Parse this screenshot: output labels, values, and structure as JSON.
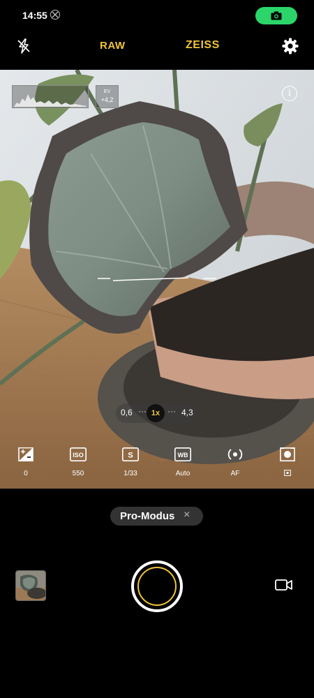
{
  "status_bar": {
    "time": "14:55",
    "icons": [
      "notification-icon",
      "camera-in-use-icon"
    ],
    "accent_color": "#2bd56a"
  },
  "top_bar": {
    "raw_label": "RAW",
    "zeiss_label": "ZEISS",
    "icons": [
      "flash-off-icon",
      "settings-icon"
    ],
    "accent_color": "#f0c43a"
  },
  "viewfinder": {
    "ev_label": "EV",
    "ev_value": "+4,2",
    "info_symbol": "i",
    "icons": [
      "histogram",
      "info-icon",
      "level-guide"
    ]
  },
  "zoom": {
    "min_label": "0,6",
    "current_label": "1x",
    "max_label": "4,3",
    "dots": "···"
  },
  "pro_controls": [
    {
      "name": "exposure-compensation",
      "value": "0",
      "icon": "exposure-icon"
    },
    {
      "name": "iso",
      "value": "550",
      "icon": "iso-icon",
      "icon_text": "ISO"
    },
    {
      "name": "shutter-speed",
      "value": "1/33",
      "icon": "shutter-speed-icon",
      "icon_text": "S"
    },
    {
      "name": "white-balance",
      "value": "Auto",
      "icon": "white-balance-icon",
      "icon_text": "WB"
    },
    {
      "name": "focus",
      "value": "AF",
      "icon": "focus-icon"
    },
    {
      "name": "metering",
      "value": "",
      "icon": "metering-icon"
    }
  ],
  "mode": {
    "label": "Pro-Modus",
    "close_symbol": "×"
  },
  "bottom": {
    "icons": [
      "gallery-thumbnail",
      "shutter-button",
      "video-icon"
    ],
    "shutter_ring_color": "#f0c43a"
  }
}
